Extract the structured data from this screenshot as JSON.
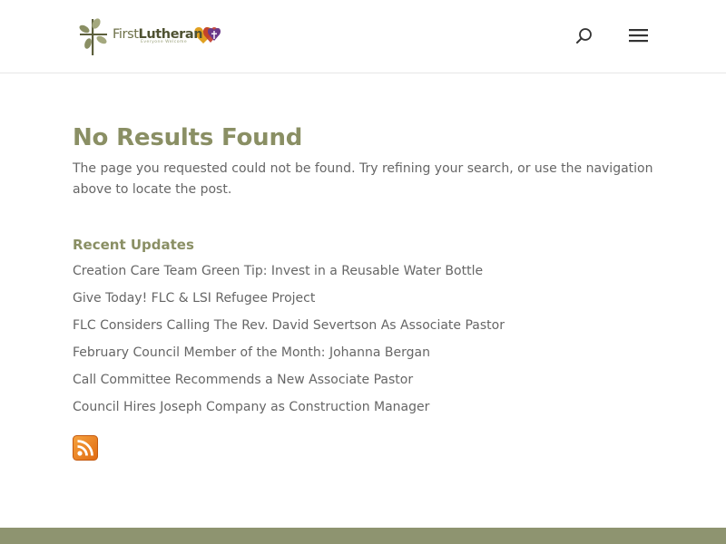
{
  "header": {
    "logo": {
      "name_part1": "First",
      "name_part2": "Lutheran",
      "tagline": "Everyone Welcome"
    },
    "search_icon": "search-icon",
    "menu_icon": "hamburger-menu-icon"
  },
  "main": {
    "title": "No Results Found",
    "message": "The page you requested could not be found. Try refining your search, or use the navigation above to locate the post.",
    "recent_heading": "Recent Updates",
    "recent_updates": [
      "Creation Care Team Green Tip: Invest in a Reusable Water Bottle",
      "Give Today! FLC & LSI Refugee Project",
      "FLC Considers Calling The Rev. David Severtson As Associate Pastor",
      "February Council Member of the Month: Johanna Bergan",
      "Call Committee Recommends a New Associate Pastor",
      "Council Hires Joseph Company as Construction Manager"
    ],
    "rss_icon": "rss-feed-icon"
  },
  "colors": {
    "accent": "#8a8f64",
    "body_text": "#666666",
    "footer": "#8e9470",
    "rss": "#f08a24"
  }
}
